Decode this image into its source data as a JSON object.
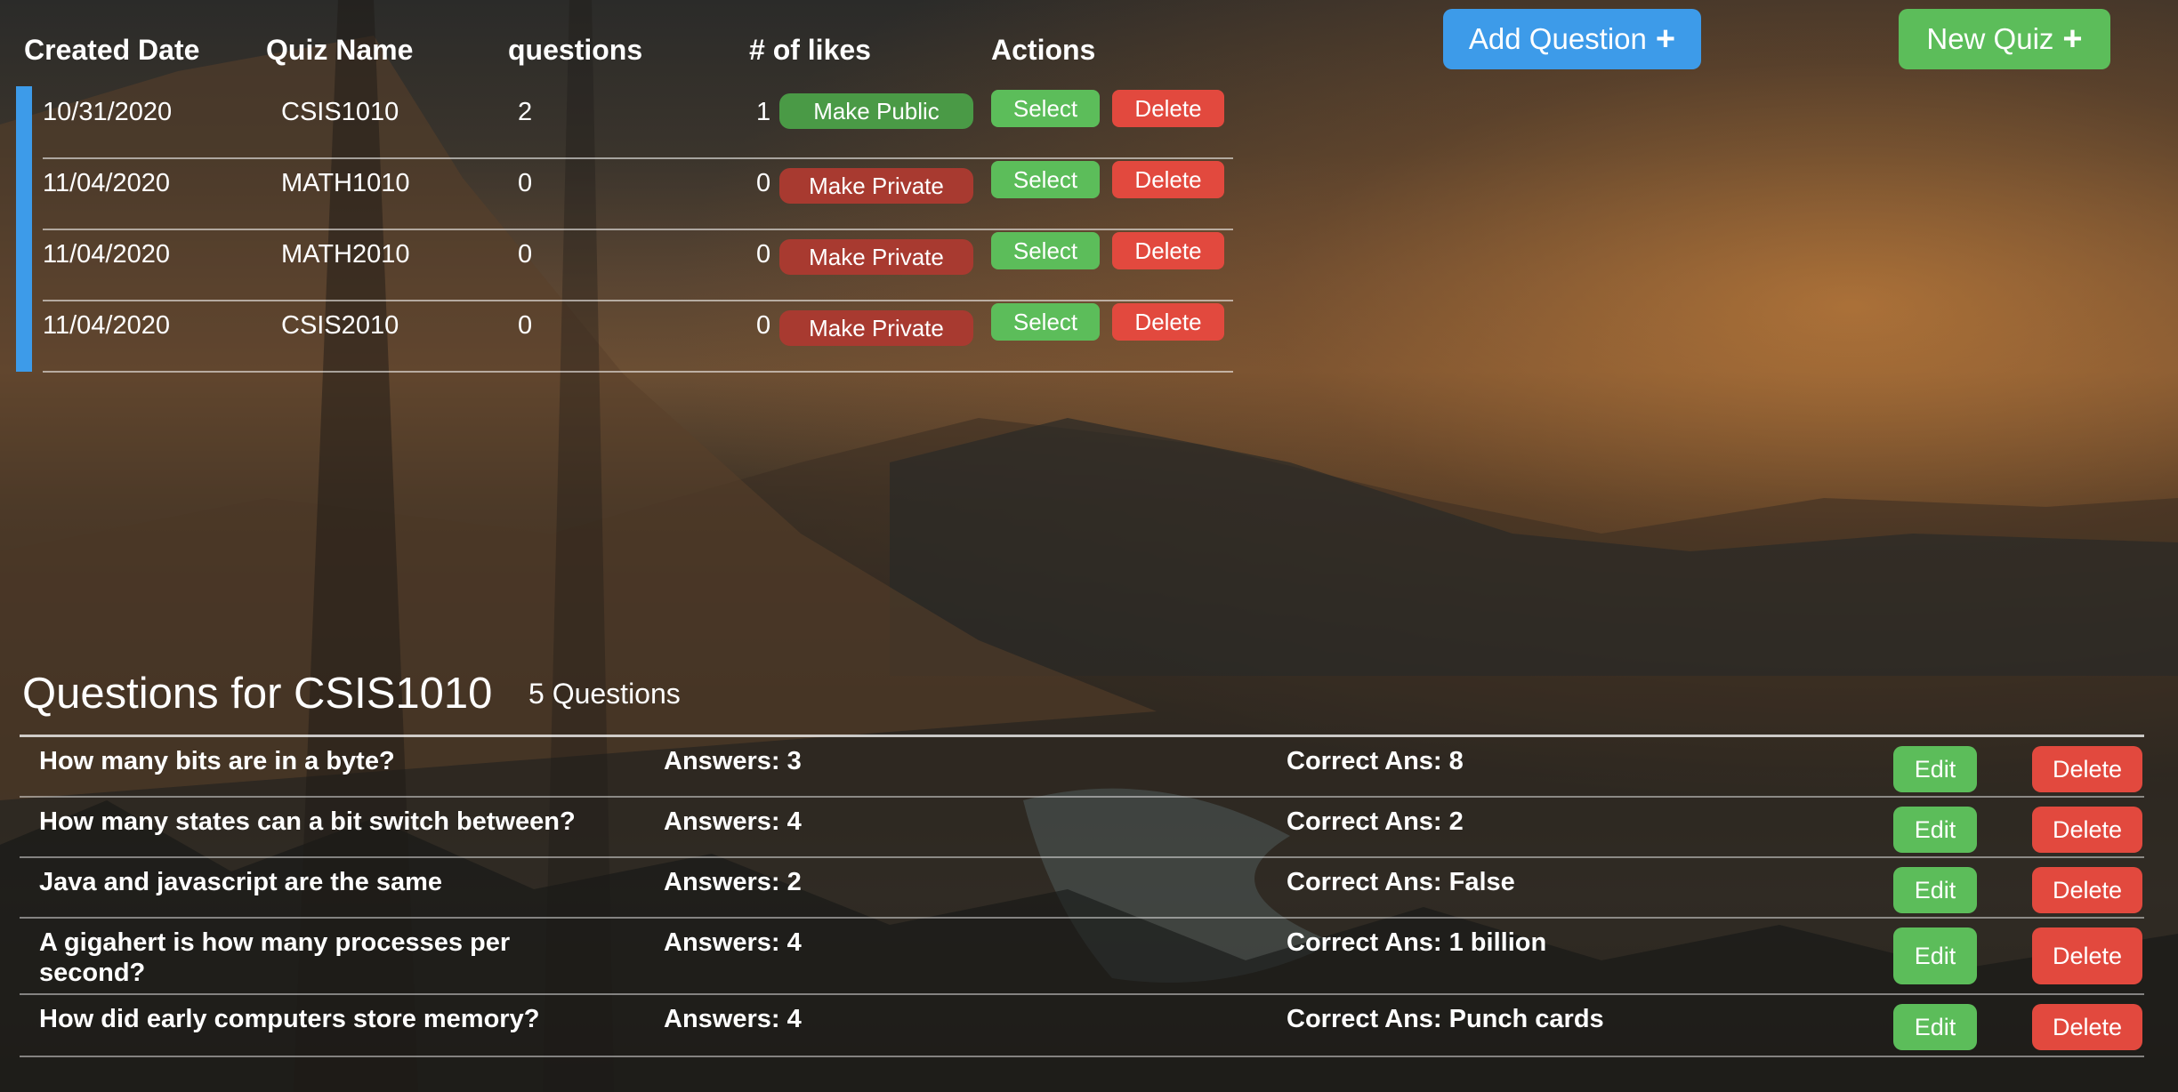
{
  "top_buttons": {
    "add_question": "Add Question",
    "new_quiz": "New Quiz",
    "plus_icon": "+",
    "colors": {
      "add_question": "#3d9be9",
      "new_quiz": "#5cbd5a"
    }
  },
  "quiz_table": {
    "headers": [
      "Created Date",
      "Quiz Name",
      "questions",
      "# of likes",
      "Actions"
    ],
    "rows": [
      {
        "date": "10/31/2020",
        "name": "CSIS1010",
        "questions": "2",
        "likes": "1",
        "visibility": "Make Public",
        "select": "Select",
        "delete": "Delete"
      },
      {
        "date": "11/04/2020",
        "name": "MATH1010",
        "questions": "0",
        "likes": "0",
        "visibility": "Make Private",
        "select": "Select",
        "delete": "Delete"
      },
      {
        "date": "11/04/2020",
        "name": "MATH2010",
        "questions": "0",
        "likes": "0",
        "visibility": "Make Private",
        "select": "Select",
        "delete": "Delete"
      },
      {
        "date": "11/04/2020",
        "name": "CSIS2010",
        "questions": "0",
        "likes": "0",
        "visibility": "Make Private",
        "select": "Select",
        "delete": "Delete"
      }
    ]
  },
  "questions_panel": {
    "title": "Questions for CSIS1010",
    "count": "5 Questions",
    "rows": [
      {
        "question": "How many bits are in a byte?",
        "answers": "Answers: 3",
        "correct": "Correct Ans: 8",
        "edit": "Edit",
        "delete": "Delete"
      },
      {
        "question": "How many states can a bit switch between?",
        "answers": "Answers: 4",
        "correct": "Correct Ans: 2",
        "edit": "Edit",
        "delete": "Delete"
      },
      {
        "question": "Java and javascript are the same",
        "answers": "Answers: 2",
        "correct": "Correct Ans: False",
        "edit": "Edit",
        "delete": "Delete"
      },
      {
        "question": "A gigahert is how many processes per second?",
        "answers": "Answers: 4",
        "correct": "Correct Ans: 1 billion",
        "edit": "Edit",
        "delete": "Delete"
      },
      {
        "question": "How did early computers store memory?",
        "answers": "Answers: 4",
        "correct": "Correct Ans: Punch cards",
        "edit": "Edit",
        "delete": "Delete"
      }
    ]
  },
  "colors": {
    "accent": "#3d9be9",
    "green": "#5cbd5a",
    "red": "#e2493e",
    "private_pill": "#a83a30",
    "public_pill": "#4a9a46"
  }
}
